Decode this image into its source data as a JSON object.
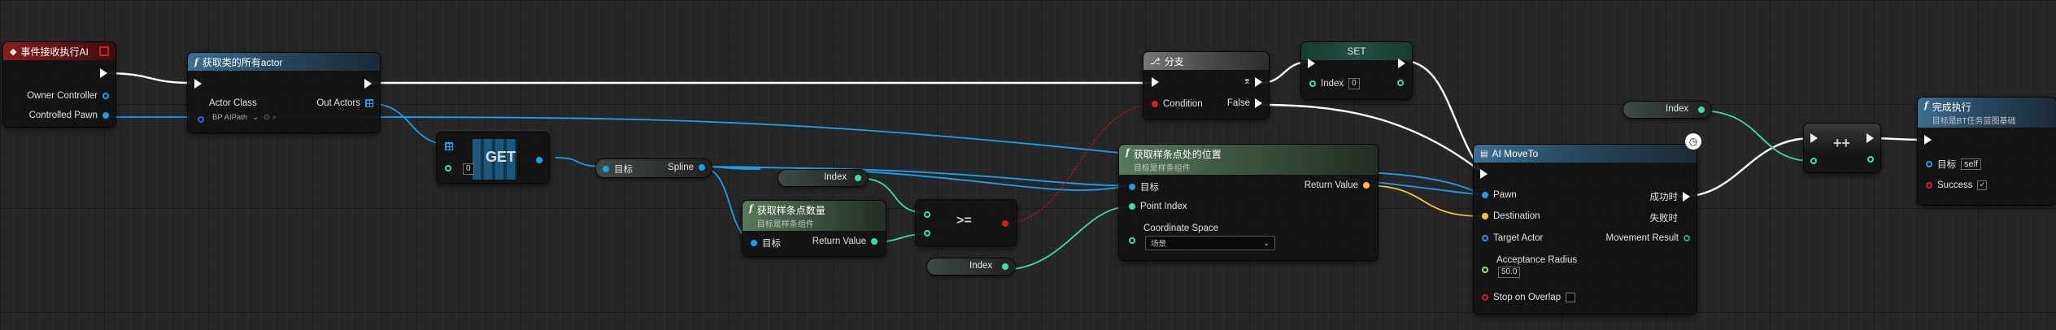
{
  "event_node": {
    "title": "事件接收执行AI",
    "pins": [
      "Owner Controller",
      "Controlled Pawn"
    ]
  },
  "get_all_actors": {
    "title": "获取类的所有actor",
    "actor_class_label": "Actor Class",
    "actor_class_value": "BP AIPath",
    "out_actors_label": "Out Actors"
  },
  "get_node": {
    "title": "GET",
    "index_value": "0"
  },
  "spline_var": {
    "target": "目标",
    "output": "Spline"
  },
  "spline_count": {
    "title": "获取样条点数量",
    "subtitle": "目标是样条组件",
    "target": "目标",
    "output": "Return Value"
  },
  "index_var_1": {
    "label": "Index"
  },
  "index_var_2": {
    "label": "Index"
  },
  "index_var_3": {
    "label": "Index"
  },
  "compare_node": {
    "label": ">="
  },
  "branch_node": {
    "title": "分支",
    "condition": "Condition",
    "false_label": "False"
  },
  "set_node": {
    "title": "SET",
    "index_label": "Index",
    "index_value": "0"
  },
  "spline_location": {
    "title": "获取样条点处的位置",
    "subtitle": "目标是样条组件",
    "target": "目标",
    "point_index": "Point Index",
    "coord_space": "Coordinate Space",
    "coord_value": "场景",
    "return_value": "Return Value"
  },
  "ai_moveto": {
    "title": "AI MoveTo",
    "pins_in": [
      "Pawn",
      "Destination",
      "Target Actor",
      "Acceptance Radius",
      "Stop on Overlap"
    ],
    "acceptance_radius": "50.0",
    "on_success": "成功时",
    "on_fail": "失败时",
    "movement_result": "Movement Result"
  },
  "increment_node": {
    "label": "++"
  },
  "finish_node": {
    "title": "完成执行",
    "subtitle": "目标是BT任务蓝图基础",
    "target": "目标",
    "target_value": "self",
    "success": "Success"
  }
}
